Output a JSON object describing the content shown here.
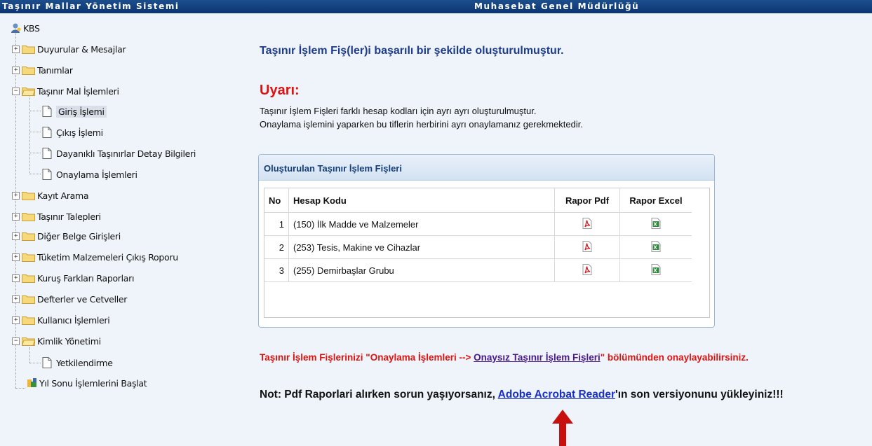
{
  "header": {
    "app_title": "Taşınır Mallar Yönetim Sistemi",
    "org_title": "Muhasebat Genel Müdürlüğü"
  },
  "sidebar": {
    "root": "KBS",
    "items": [
      {
        "label": "Duyurular & Mesajlar",
        "toggle": "+"
      },
      {
        "label": "Tanımlar",
        "toggle": "+"
      },
      {
        "label": "Taşınır Mal İşlemleri",
        "toggle": "−"
      },
      {
        "label": "Giriş İşlemi"
      },
      {
        "label": "Çıkış İşlemi"
      },
      {
        "label": "Dayanıklı Taşınırlar Detay Bilgileri"
      },
      {
        "label": "Onaylama İşlemleri"
      },
      {
        "label": "Kayıt Arama",
        "toggle": "+"
      },
      {
        "label": "Taşınır Talepleri",
        "toggle": "+"
      },
      {
        "label": "Diğer Belge Girişleri",
        "toggle": "+"
      },
      {
        "label": "Tüketim Malzemeleri Çıkış Roporu",
        "toggle": "+"
      },
      {
        "label": "Kuruş Farkları Raporları",
        "toggle": "+"
      },
      {
        "label": "Defterler ve Cetveller",
        "toggle": "+"
      },
      {
        "label": "Kullanıcı İşlemleri",
        "toggle": "+"
      },
      {
        "label": "Kimlik Yönetimi",
        "toggle": "−"
      },
      {
        "label": "Yetkilendirme"
      },
      {
        "label": "Yıl Sonu İşlemlerini Başlat"
      }
    ]
  },
  "main": {
    "success_message": "Taşınır İşlem Fiş(ler)i başarılı bir şekilde oluşturulmuştur.",
    "warning_title": "Uyarı:",
    "warning_lines": [
      "Taşınır İşlem Fişleri farklı hesap kodları için ayrı ayrı oluşturulmuştur.",
      "Onaylama işlemini yaparken bu tiflerin herbirini ayrı onaylamanız gerekmektedir."
    ],
    "panel_title": "Oluşturulan Taşınır İşlem Fişleri",
    "table": {
      "headers": [
        "No",
        "Hesap Kodu",
        "Rapor Pdf",
        "Rapor Excel"
      ],
      "rows": [
        {
          "no": "1",
          "code": "(150) İlk Madde ve Malzemeler"
        },
        {
          "no": "2",
          "code": "(253) Tesis, Makine ve Cihazlar"
        },
        {
          "no": "3",
          "code": "(255) Demirbaşlar Grubu"
        }
      ]
    },
    "note1_pre": "Taşınır İşlem Fişlerinizi \"Onaylama İşlemleri --> ",
    "note1_link": "Onaysız Taşınır İşlem Fişleri",
    "note1_post": "\" bölümünden onaylayabilirsiniz.",
    "note2_pre": "Not: Pdf Raporlari alırken sorun yaşıyorsanız, ",
    "note2_link": "Adobe Acrobat Reader",
    "note2_post": "'ın son versiyonunu yükleyiniz!!!",
    "icons": {
      "pdf": "pdf-icon",
      "excel": "excel-icon",
      "arrow": "red-arrow-up"
    },
    "colors": {
      "accent_red": "#e0120f",
      "header_blue": "#0b3572",
      "link_purple": "#4a1a8c",
      "link_blue": "#1a2fc8"
    }
  }
}
